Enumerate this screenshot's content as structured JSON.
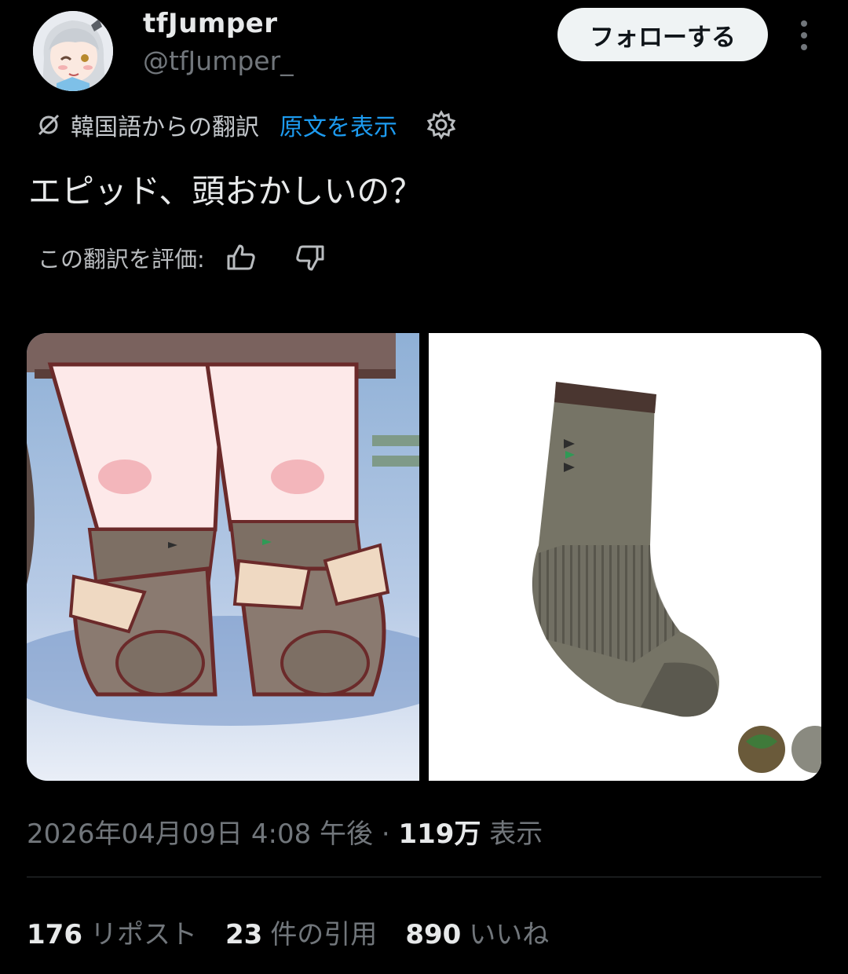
{
  "author": {
    "display_name": "tfJumper",
    "handle": "@tfJumper_",
    "follow_label": "フォローする"
  },
  "translation": {
    "from_label": "韓国語からの翻訳",
    "show_original_label": "原文を表示"
  },
  "tweet": {
    "text": "エピッド、頭おかしいの？"
  },
  "rating": {
    "prompt": "この翻訳を評価:"
  },
  "meta": {
    "datetime": "2026年04月09日 4:08 午後",
    "separator": "·",
    "views_count": "119万",
    "views_label": "表示"
  },
  "stats": [
    {
      "count": "176",
      "label": "リポスト"
    },
    {
      "count": "23",
      "label": "件の引用"
    },
    {
      "count": "890",
      "label": "いいね"
    }
  ],
  "icons": [
    "translate-icon",
    "gear-icon",
    "thumbs-up-icon",
    "thumbs-down-icon",
    "more-icon"
  ],
  "colors": {
    "background": "#000000",
    "link": "#1d9bf0",
    "muted": "#71767b",
    "follow_bg": "#eff3f4"
  }
}
